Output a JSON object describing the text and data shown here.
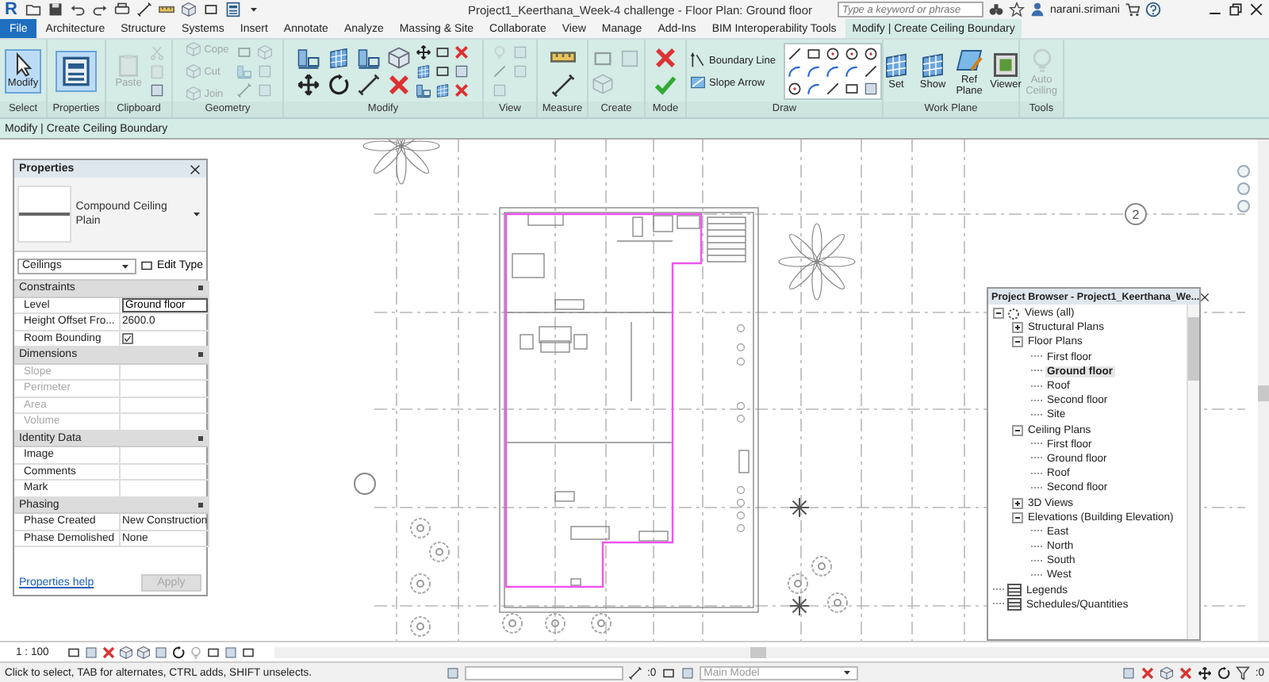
{
  "title_bar": {
    "app_logo": "R",
    "title": "Project1_Keerthana_Week-4 challenge - Floor Plan: Ground floor",
    "search": {
      "placeholder": "Type a keyword or phrase"
    },
    "user": "narani.srimani"
  },
  "ribbon_tabs": [
    {
      "label": "File",
      "kind": "file",
      "selected": false
    },
    {
      "label": "Architecture",
      "kind": "tab",
      "selected": false
    },
    {
      "label": "Structure",
      "kind": "tab",
      "selected": false
    },
    {
      "label": "Systems",
      "kind": "tab",
      "selected": false
    },
    {
      "label": "Insert",
      "kind": "tab",
      "selected": false
    },
    {
      "label": "Annotate",
      "kind": "tab",
      "selected": false
    },
    {
      "label": "Analyze",
      "kind": "tab",
      "selected": false
    },
    {
      "label": "Massing & Site",
      "kind": "tab",
      "selected": false
    },
    {
      "label": "Collaborate",
      "kind": "tab",
      "selected": false
    },
    {
      "label": "View",
      "kind": "tab",
      "selected": false
    },
    {
      "label": "Manage",
      "kind": "tab",
      "selected": false
    },
    {
      "label": "Add-Ins",
      "kind": "tab",
      "selected": false
    },
    {
      "label": "BIM Interoperability Tools",
      "kind": "tab",
      "selected": false
    },
    {
      "label": "Modify | Create Ceiling Boundary",
      "kind": "context",
      "selected": true
    }
  ],
  "ribbon_panels": [
    {
      "kind": "select",
      "label": "Select",
      "tools": [
        {
          "label": "Modify",
          "selected": true,
          "disabled": false
        }
      ]
    },
    {
      "kind": "properties",
      "label": "Properties",
      "toggle_on": true
    },
    {
      "kind": "clipboard",
      "label": "Clipboard",
      "tools": [
        {
          "label": "Paste",
          "selected": false,
          "disabled": true
        }
      ]
    },
    {
      "kind": "geometry",
      "label": "Geometry",
      "tools": [
        {
          "label": "Cope",
          "selected": false,
          "disabled": true
        },
        {
          "label": "Cut",
          "selected": false,
          "disabled": true
        },
        {
          "label": "Join",
          "selected": false,
          "disabled": true
        }
      ]
    },
    {
      "kind": "modify",
      "label": "Modify"
    },
    {
      "kind": "view",
      "label": "View"
    },
    {
      "kind": "measure",
      "label": "Measure"
    },
    {
      "kind": "create",
      "label": "Create"
    },
    {
      "kind": "mode",
      "label": "Mode"
    },
    {
      "kind": "draw",
      "label": "Draw",
      "tools": [
        {
          "label": "Boundary Line",
          "selected": false,
          "disabled": false
        },
        {
          "label": "Slope Arrow",
          "selected": false,
          "disabled": false
        }
      ]
    },
    {
      "kind": "workplane",
      "label": "Work Plane",
      "tools": [
        {
          "label": "Set",
          "selected": false,
          "disabled": false
        },
        {
          "label": "Show",
          "selected": false,
          "disabled": false
        },
        {
          "label": "Ref Plane",
          "selected": false,
          "disabled": false
        },
        {
          "label": "Viewer",
          "selected": false,
          "disabled": false
        }
      ]
    },
    {
      "kind": "tools",
      "label": "Tools",
      "tools": [
        {
          "label": "Auto Ceiling",
          "selected": false,
          "disabled": true
        }
      ]
    }
  ],
  "context_bar": "Modify | Create Ceiling Boundary",
  "canvas": {
    "grid_bubble": "2"
  },
  "properties_palette": {
    "title": "Properties",
    "type_name": "Compound Ceiling Plain",
    "category": "Ceilings",
    "edit_type": "Edit Type",
    "groups": [
      {
        "name": "Constraints",
        "rows": [
          {
            "kind": "field",
            "label": "Level",
            "value": "Ground floor",
            "disabled": false
          },
          {
            "kind": "text",
            "label": "Height Offset Fro...",
            "value": "2600.0",
            "disabled": false
          },
          {
            "kind": "checkbox",
            "label": "Room Bounding",
            "checked": true,
            "disabled": false
          }
        ]
      },
      {
        "name": "Dimensions",
        "rows": [
          {
            "kind": "text",
            "label": "Slope",
            "disabled": true
          },
          {
            "kind": "text",
            "label": "Perimeter",
            "disabled": true
          },
          {
            "kind": "text",
            "label": "Area",
            "disabled": true
          },
          {
            "kind": "text",
            "label": "Volume",
            "disabled": true
          }
        ]
      },
      {
        "name": "Identity Data",
        "rows": [
          {
            "kind": "text",
            "label": "Image",
            "disabled": false
          },
          {
            "kind": "text",
            "label": "Comments",
            "disabled": false
          },
          {
            "kind": "text",
            "label": "Mark",
            "disabled": false
          }
        ]
      },
      {
        "name": "Phasing",
        "rows": [
          {
            "kind": "text",
            "label": "Phase Created",
            "value": "New Construction",
            "disabled": false
          },
          {
            "kind": "text",
            "label": "Phase Demolished",
            "value": "None",
            "disabled": false
          }
        ]
      }
    ],
    "help_link": "Properties help",
    "apply": {
      "label": "Apply",
      "disabled": true
    }
  },
  "project_browser": {
    "title": "Project Browser - Project1_Keerthana_We...",
    "items": [
      {
        "label": "Views (all)",
        "kind": "views",
        "expanded": true,
        "selected": false,
        "children": [
          {
            "label": "Structural Plans",
            "kind": "group",
            "expanded": false,
            "selected": false
          },
          {
            "label": "Floor Plans",
            "kind": "group",
            "expanded": true,
            "selected": false,
            "children": [
              {
                "label": "First floor",
                "kind": "view",
                "selected": false
              },
              {
                "label": "Ground floor",
                "kind": "view",
                "selected": true
              },
              {
                "label": "Roof",
                "kind": "view",
                "selected": false
              },
              {
                "label": "Second floor",
                "kind": "view",
                "selected": false
              },
              {
                "label": "Site",
                "kind": "view",
                "selected": false
              }
            ]
          },
          {
            "label": "Ceiling Plans",
            "kind": "group",
            "expanded": true,
            "selected": false,
            "children": [
              {
                "label": "First floor",
                "kind": "view",
                "selected": false
              },
              {
                "label": "Ground floor",
                "kind": "view",
                "selected": false
              },
              {
                "label": "Roof",
                "kind": "view",
                "selected": false
              },
              {
                "label": "Second floor",
                "kind": "view",
                "selected": false
              }
            ]
          },
          {
            "label": "3D Views",
            "kind": "group",
            "expanded": false,
            "selected": false
          },
          {
            "label": "Elevations (Building Elevation)",
            "kind": "group",
            "expanded": true,
            "selected": false,
            "children": [
              {
                "label": "East",
                "kind": "view",
                "selected": false
              },
              {
                "label": "North",
                "kind": "view",
                "selected": false
              },
              {
                "label": "South",
                "kind": "view",
                "selected": false
              },
              {
                "label": "West",
                "kind": "view",
                "selected": false
              }
            ]
          }
        ]
      },
      {
        "label": "Legends",
        "kind": "legends",
        "selected": false
      },
      {
        "label": "Schedules/Quantities",
        "kind": "schedules",
        "selected": false
      }
    ]
  },
  "view_bar": {
    "scale": "1 : 100"
  },
  "status_bar": {
    "message": "Click to select, TAB for alternates, CTRL adds, SHIFT unselects.",
    "editable_count": ":0",
    "design_option": "Main Model",
    "filter_count": ":0"
  }
}
